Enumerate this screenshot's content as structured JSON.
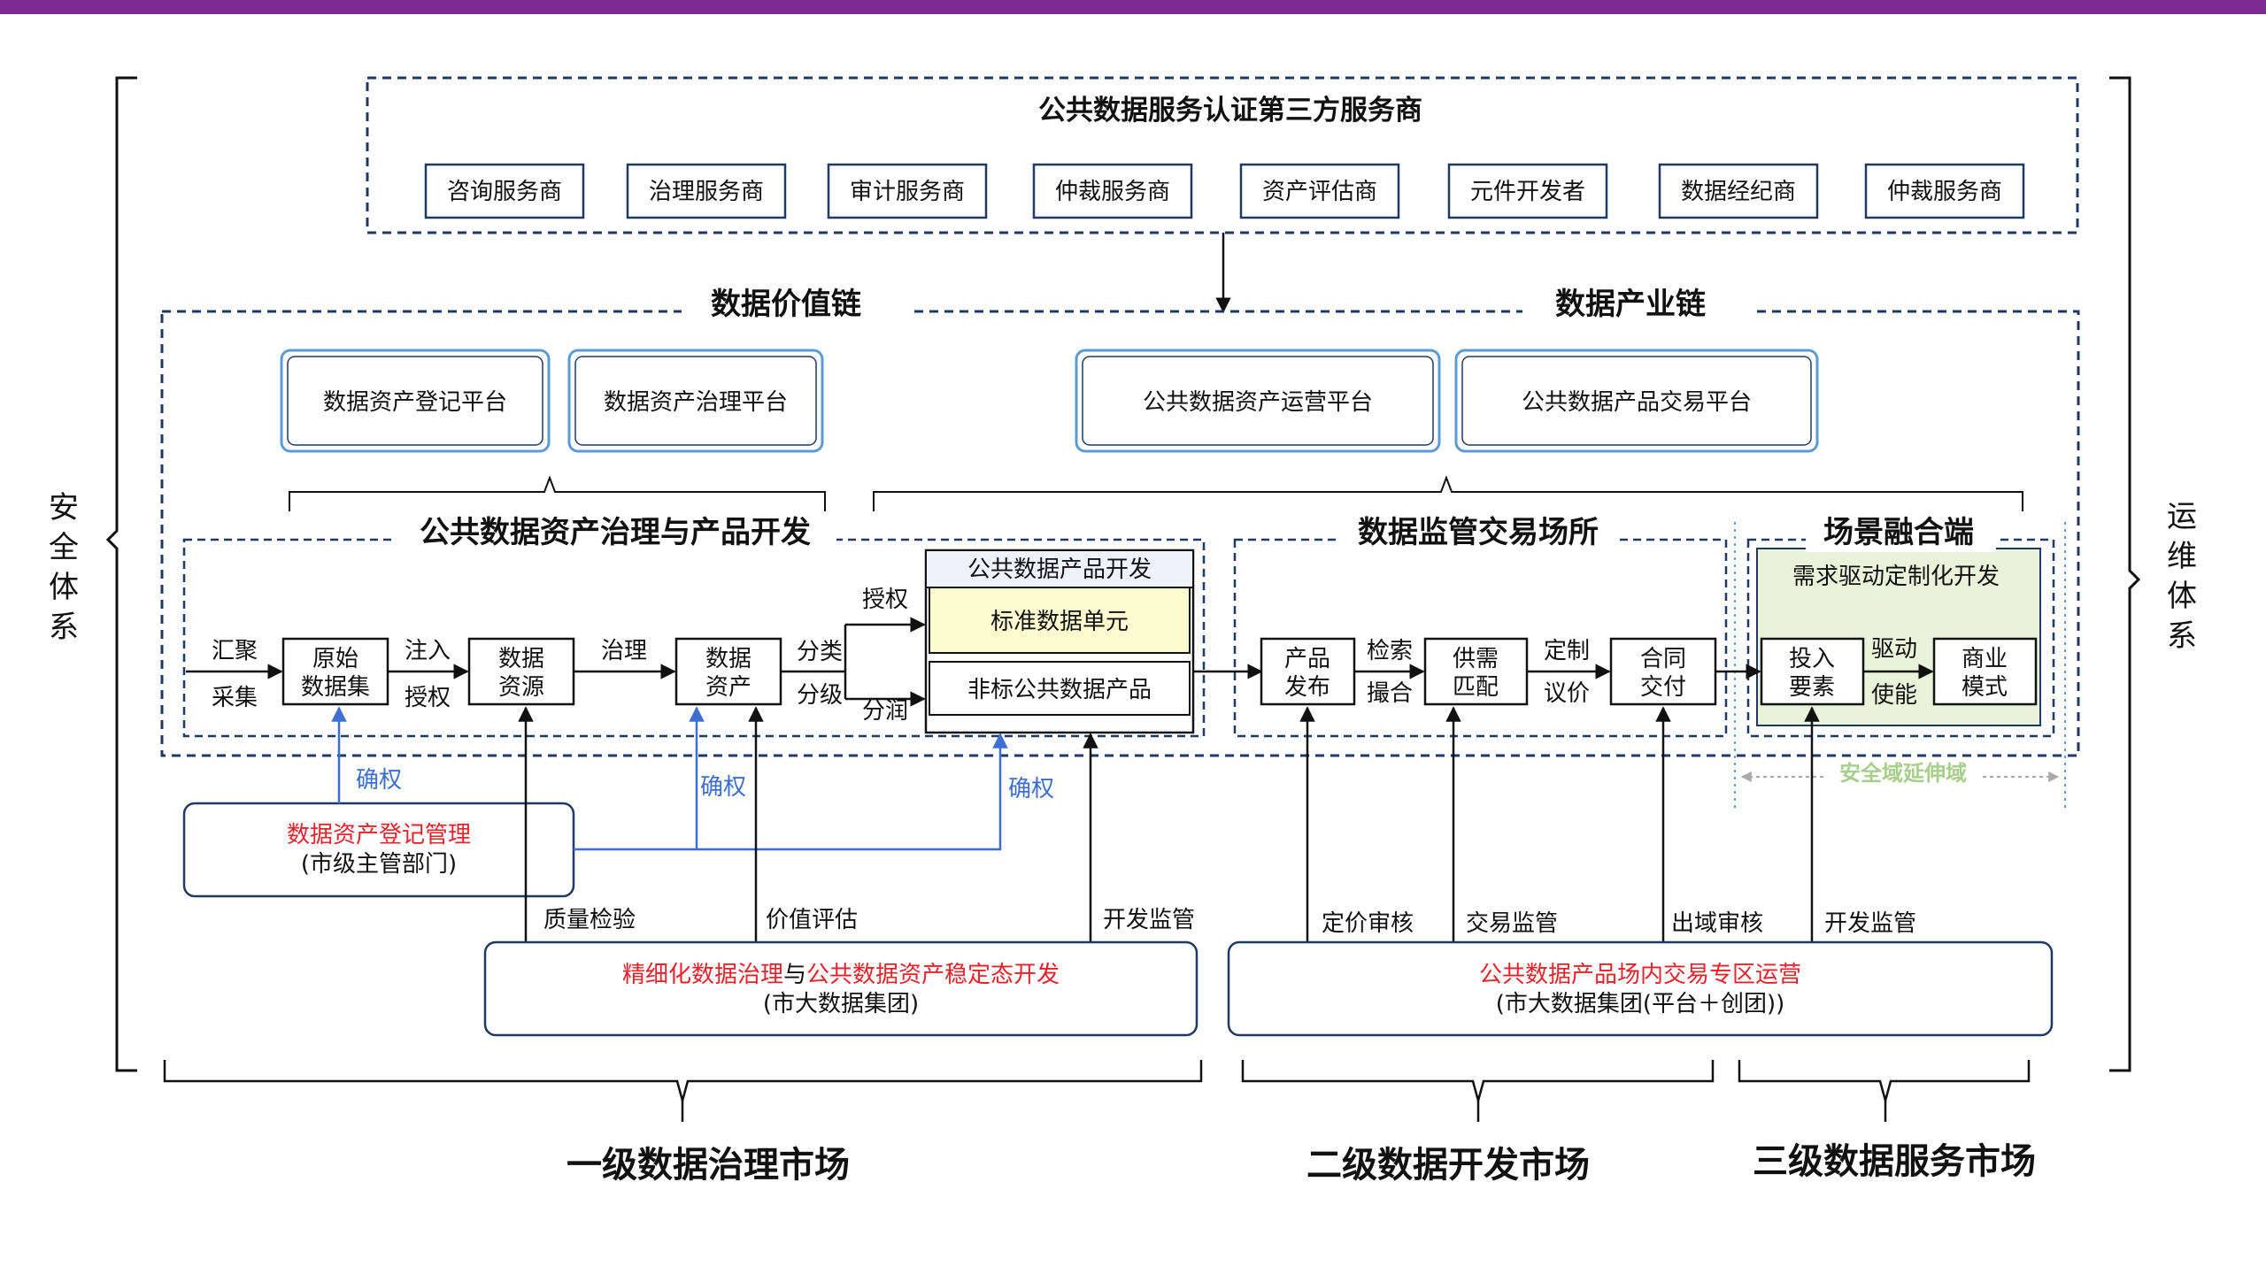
{
  "colors": {
    "top_bar": "#7a2c91",
    "dashed_border": "#1f3864",
    "platform_border": "#5b9bd5",
    "accent_blue": "#3d6fd1",
    "accent_red": "#e8212a",
    "highlight_yellow": "#fdfbd0",
    "scenario_green": "#e8f3d9",
    "extend_green": "#a8cf8a"
  },
  "side": {
    "left": "安全体系",
    "right": "运维体系"
  },
  "third_party": {
    "title": "公共数据服务认证第三方服务商",
    "providers": [
      "咨询服务商",
      "治理服务商",
      "审计服务商",
      "仲裁服务商",
      "资产评估商",
      "元件开发者",
      "数据经纪商",
      "仲裁服务商"
    ]
  },
  "chains": {
    "value_chain": "数据价值链",
    "industry_chain": "数据产业链"
  },
  "platforms": [
    "数据资产登记平台",
    "数据资产治理平台",
    "公共数据资产运营平台",
    "公共数据产品交易平台"
  ],
  "governance": {
    "title": "公共数据资产治理与产品开发",
    "in_top": "汇聚",
    "in_bottom": "采集",
    "raw": [
      "原始",
      "数据集"
    ],
    "inject": "注入",
    "authorize": "授权",
    "resource": [
      "数据",
      "资源"
    ],
    "govern": "治理",
    "asset": [
      "数据",
      "资产"
    ],
    "classify": "分类",
    "grade": "分级",
    "license": "授权",
    "share": "分润",
    "product_dev": "公共数据产品开发",
    "standard_unit": "标准数据单元",
    "nonstandard": "非标公共数据产品"
  },
  "exchange": {
    "title": "数据监管交易场所",
    "publish": [
      "产品",
      "发布"
    ],
    "search": "检索",
    "match_verb": "撮合",
    "match": [
      "供需",
      "匹配"
    ],
    "customize": "定制",
    "negotiate": "议价",
    "contract": [
      "合同",
      "交付"
    ]
  },
  "scenario": {
    "title": "场景融合端",
    "demand": "需求驱动定制化开发",
    "input": [
      "投入",
      "要素"
    ],
    "drive": "驱动",
    "enable": "使能",
    "business": [
      "商业",
      "模式"
    ],
    "extend": "安全域延伸域"
  },
  "confirm_labels": [
    "确权",
    "确权",
    "确权"
  ],
  "registry": {
    "title": "数据资产登记管理",
    "org": "(市级主管部门)"
  },
  "supervision": {
    "quality": "质量检验",
    "value": "价值评估",
    "dev": "开发监管",
    "pricing": "定价审核",
    "trade": "交易监管",
    "outbound": "出域审核",
    "dev2": "开发监管"
  },
  "group1": {
    "title_red1": "精细化数据治理",
    "title_mid": "与",
    "title_red2": "公共数据资产稳定态开发",
    "org": "(市大数据集团)"
  },
  "group2": {
    "title": "公共数据产品场内交易专区运营",
    "org": "(市大数据集团(平台＋创团))"
  },
  "markets": [
    "一级数据治理市场",
    "二级数据开发市场",
    "三级数据服务市场"
  ]
}
